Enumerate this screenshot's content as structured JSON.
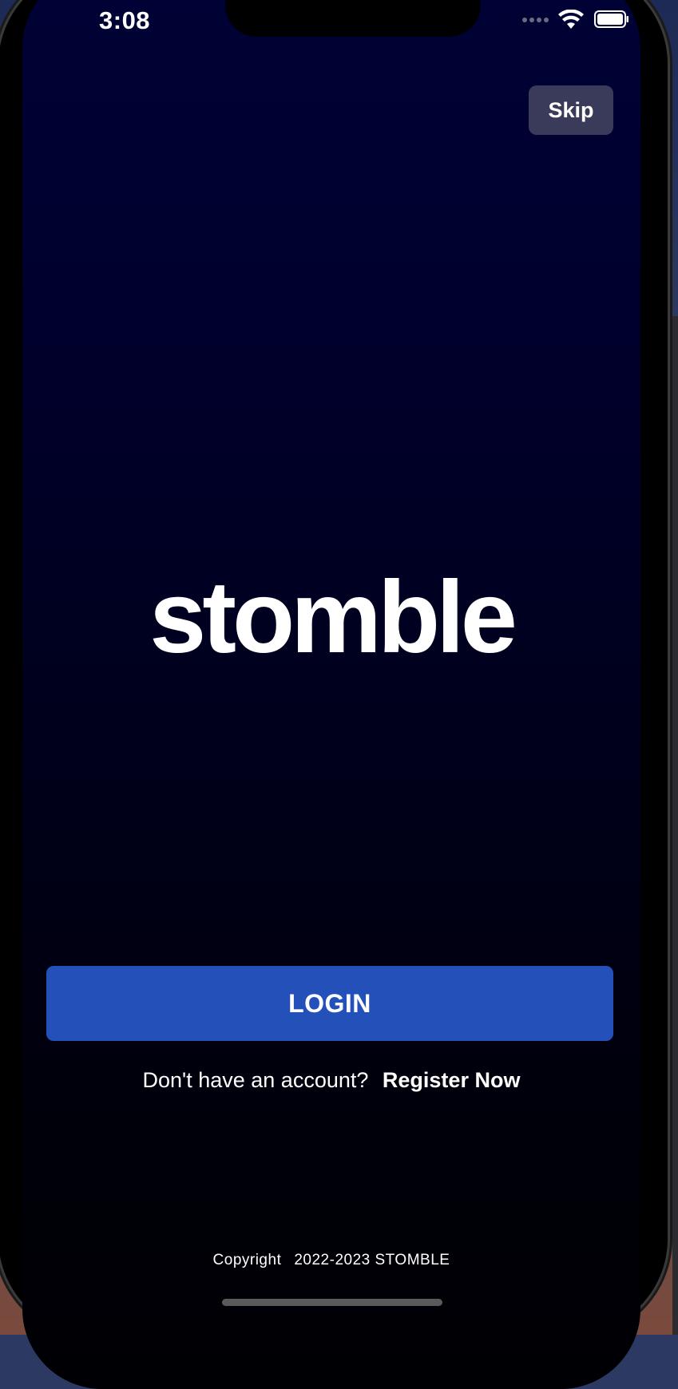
{
  "status_bar": {
    "time": "3:08",
    "icons": [
      "cellular-signal-icon",
      "wifi-icon",
      "battery-icon"
    ]
  },
  "header": {
    "skip_label": "Skip"
  },
  "brand": {
    "logo_text": "stomble"
  },
  "actions": {
    "login_label": "LOGIN",
    "register_prompt": "Don't have an account?",
    "register_link": "Register Now"
  },
  "footer": {
    "copyright_label": "Copyright",
    "copyright_text": "2022-2023 STOMBLE"
  },
  "colors": {
    "background_top": "#000236",
    "background_bottom": "#000004",
    "login_button": "#2350b9",
    "skip_button": "#3a3a5a",
    "text": "#ffffff"
  }
}
